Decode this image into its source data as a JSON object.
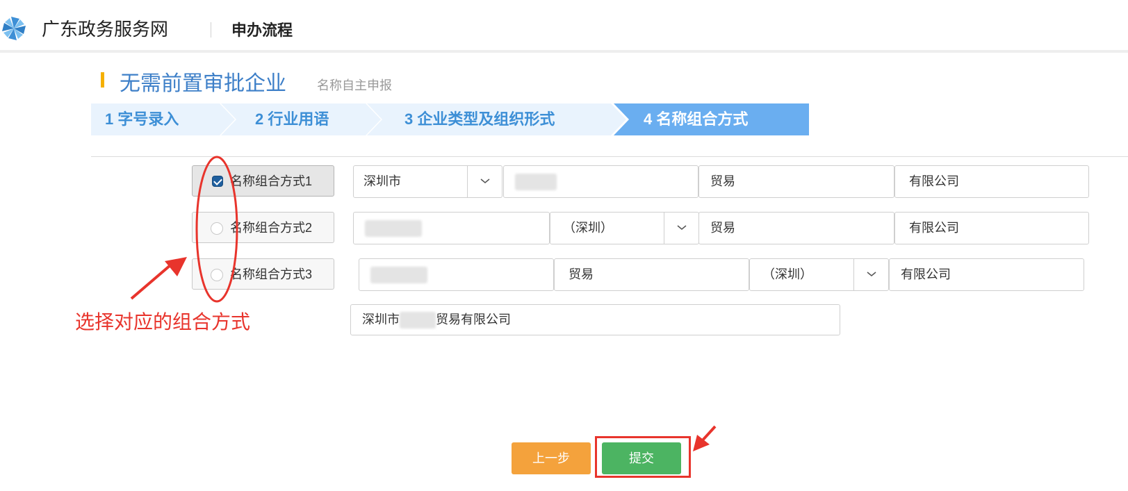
{
  "header": {
    "site_name": "广东政务服务网",
    "section": "申办流程",
    "logo_icon": "pinwheel-logo-icon"
  },
  "page": {
    "title": "无需前置审批企业",
    "subtitle": "名称自主申报"
  },
  "steps": [
    {
      "label": "1 字号录入",
      "active": false
    },
    {
      "label": "2 行业用语",
      "active": false
    },
    {
      "label": "3 企业类型及组织形式",
      "active": false
    },
    {
      "label": "4 名称组合方式",
      "active": true
    }
  ],
  "options": [
    {
      "label": "名称组合方式1",
      "selected": true,
      "region": "深圳市",
      "industry": "贸易",
      "org_form": "有限公司"
    },
    {
      "label": "名称组合方式2",
      "selected": false,
      "region": "（深圳）",
      "industry": "贸易",
      "org_form": "有限公司"
    },
    {
      "label": "名称组合方式3",
      "selected": false,
      "industry": "贸易",
      "region": "（深圳）",
      "org_form": "有限公司"
    }
  ],
  "result": {
    "prefix": "深圳市",
    "suffix": "贸易有限公司"
  },
  "annotation": {
    "text": "选择对应的组合方式"
  },
  "buttons": {
    "prev": "上一步",
    "submit": "提交"
  },
  "colors": {
    "brand_blue": "#3d7fc8",
    "active_step": "#6aaef0",
    "inactive_step": "#e9f3fd",
    "accent_yellow": "#f5b000",
    "annotation_red": "#e8342c",
    "prev_orange": "#f4a23c",
    "submit_green": "#4cb462"
  }
}
